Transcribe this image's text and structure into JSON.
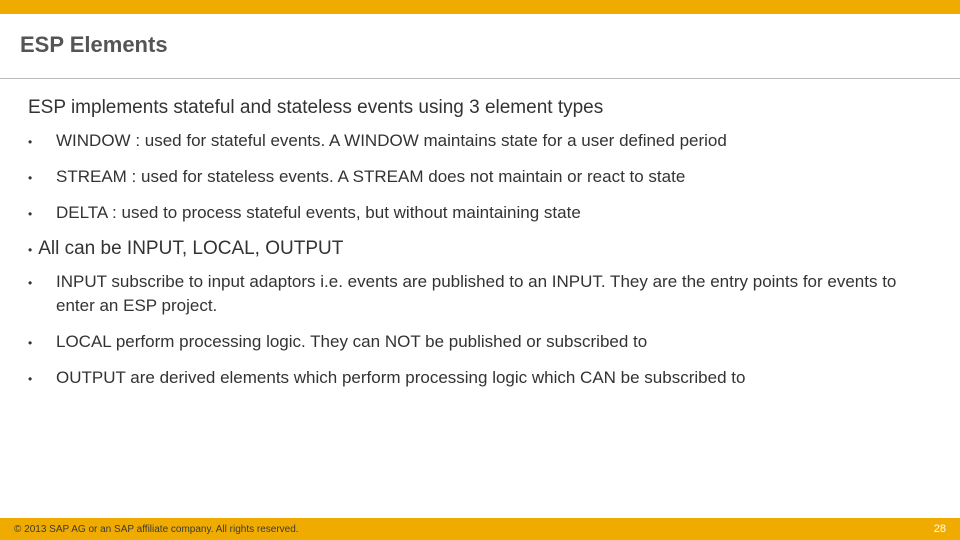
{
  "title": "ESP Elements",
  "lead": "ESP implements stateful and stateless events using 3 element types",
  "bullets1": [
    "WINDOW : used for stateful events.  A WINDOW maintains state for a user defined period",
    "STREAM : used for stateless events.  A STREAM does not maintain or react to state",
    "DELTA : used to process stateful events, but without maintaining state"
  ],
  "sub_lead": "All can be INPUT, LOCAL, OUTPUT",
  "bullets2": [
    "INPUT subscribe to input adaptors i.e. events are published to an INPUT.  They are the entry points for events to enter an ESP project.",
    "LOCAL perform processing logic.  They can NOT be published or subscribed to",
    "OUTPUT are derived elements which perform processing logic which CAN be subscribed to"
  ],
  "footer": {
    "copyright": "© 2013 SAP AG or an SAP affiliate company. All rights reserved.",
    "page": "28"
  }
}
